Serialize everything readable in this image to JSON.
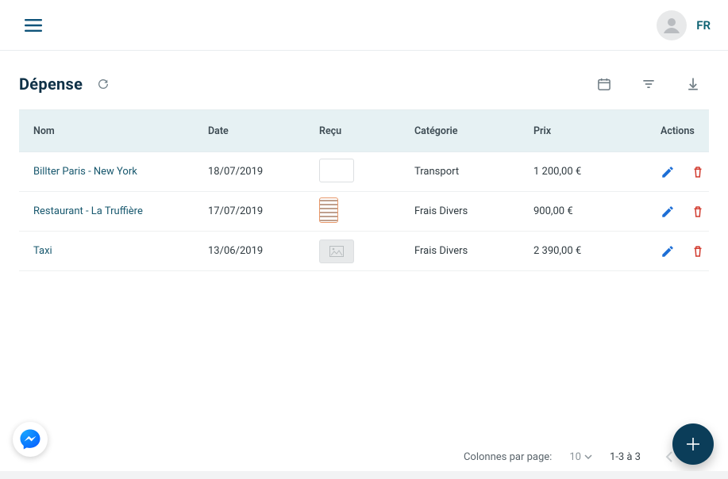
{
  "header": {
    "lang": "FR"
  },
  "page": {
    "title": "Dépense"
  },
  "table": {
    "head": {
      "name": "Nom",
      "date": "Date",
      "receipt": "Reçu",
      "category": "Catégorie",
      "price": "Prix",
      "actions": "Actions"
    },
    "rows": [
      {
        "name": "Billter Paris - New York",
        "date": "18/07/2019",
        "thumb": "lines",
        "category": "Transport",
        "price": "1 200,00 €"
      },
      {
        "name": "Restaurant - La Truffière",
        "date": "17/07/2019",
        "thumb": "vertical",
        "category": "Frais Divers",
        "price": "900,00 €"
      },
      {
        "name": "Taxi",
        "date": "13/06/2019",
        "thumb": "placeholder",
        "category": "Frais Divers",
        "price": "2 390,00 €"
      }
    ]
  },
  "footer": {
    "rows_label": "Colonnes par page:",
    "rows_value": "10",
    "range_label": "1-3 à 3"
  }
}
